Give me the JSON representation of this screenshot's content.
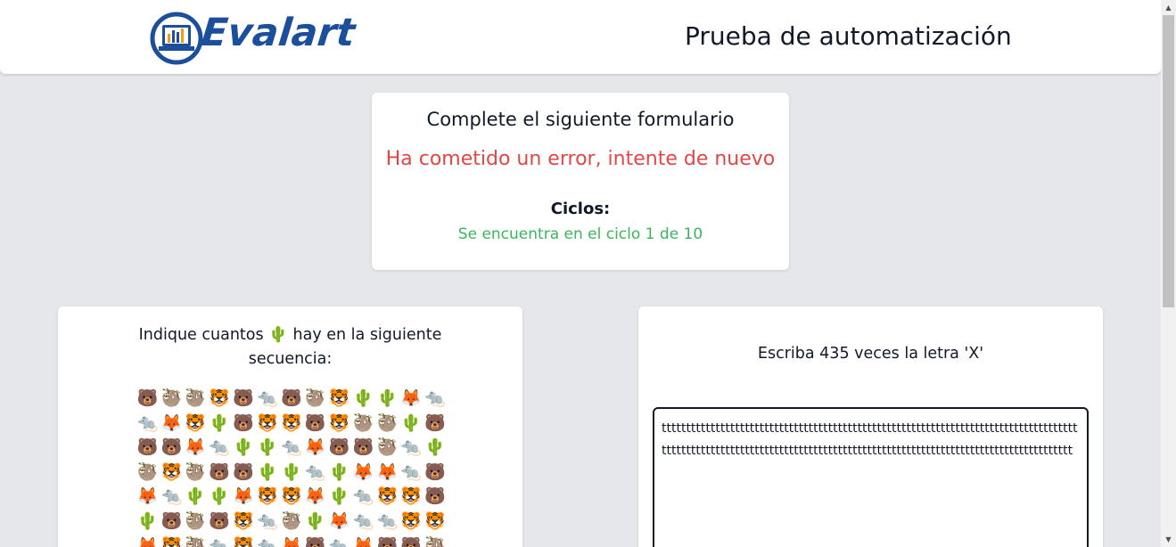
{
  "header": {
    "logo_text": "Evalart",
    "title": "Prueba de automatización"
  },
  "form": {
    "title": "Complete el siguiente formulario",
    "error": "Ha cometido un error, intente de nuevo",
    "cycles_label": "Ciclos:",
    "cycles_status": "Se encuentra en el ciclo 1 de 10"
  },
  "question": {
    "text_before": "Indique cuantos ",
    "target_emoji": "🌵",
    "text_after": " hay en la siguiente secuencia:",
    "emojis": [
      "🐻",
      "🦥",
      "🦥",
      "🐯",
      "🐻",
      "🐀",
      "🐻",
      "🦥",
      "🐯",
      "🌵",
      "🌵",
      "🦊",
      "🐀",
      "🐀",
      "🦊",
      "🐯",
      "🌵",
      "🐻",
      "🐯",
      "🐯",
      "🐻",
      "🐯",
      "🦥",
      "🦥",
      "🌵",
      "🐻",
      "🐻",
      "🐻",
      "🦊",
      "🐀",
      "🌵",
      "🌵",
      "🐀",
      "🦊",
      "🐻",
      "🐻",
      "🦥",
      "🐀",
      "🌵",
      "🦥",
      "🐯",
      "🦥",
      "🐻",
      "🐻",
      "🌵",
      "🌵",
      "🐀",
      "🌵",
      "🦊",
      "🦊",
      "🐀",
      "🐻",
      "🦊",
      "🐀",
      "🌵",
      "🌵",
      "🦊",
      "🐯",
      "🐯",
      "🦊",
      "🌵",
      "🐀",
      "🐯",
      "🐯",
      "🐻",
      "🌵",
      "🐻",
      "🦥",
      "🐻",
      "🐯",
      "🐀",
      "🦥",
      "🌵",
      "🦊",
      "🐀",
      "🐀",
      "🐯",
      "🐯",
      "🦊",
      "🐯",
      "🦥",
      "🐀",
      "🐯",
      "🐀",
      "🦊",
      "🐻",
      "🐀",
      "🦊",
      "🐻",
      "🐻",
      "🦥"
    ]
  },
  "letters": {
    "instruction": "Escriba 435 veces la letra 'X'",
    "answer_value": "ttttttttttttttttttttttttttttttttttttttttttttttttttttttttttttttttttttttttttttttttttttttttttttttttttttttttttttttttttttttttttttttttttttttttttttttttttttttttttttttttttttttttt"
  }
}
